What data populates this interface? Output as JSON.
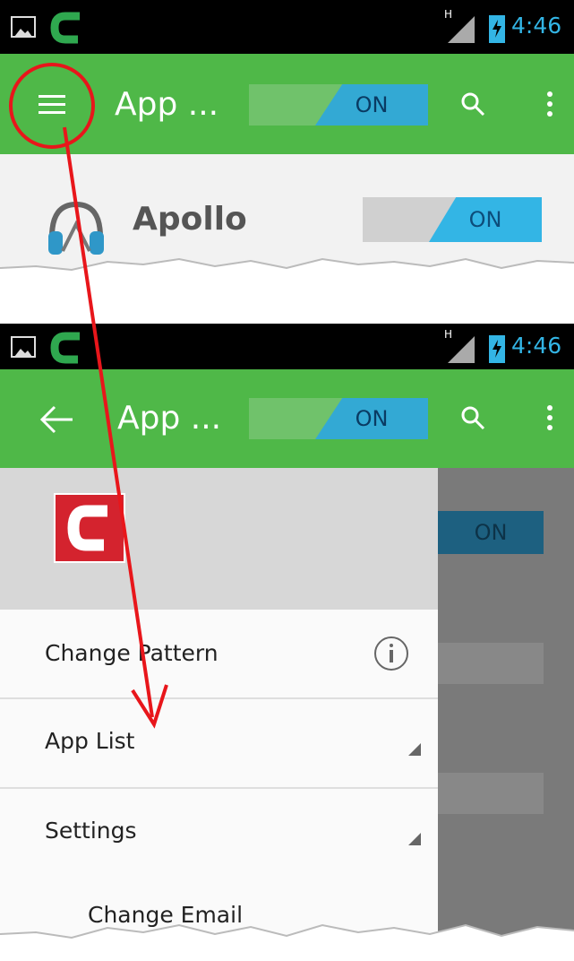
{
  "screen1": {
    "status_time": "4:46",
    "app_title": "App ...",
    "header_toggle": "ON",
    "app_row": {
      "name": "Apollo",
      "toggle": "ON"
    }
  },
  "screen2": {
    "status_time": "4:46",
    "app_title": "App ...",
    "header_toggle": "ON",
    "bg_toggle": "ON",
    "drawer": {
      "logo_letter": "C",
      "items": [
        {
          "label": "Change Pattern"
        },
        {
          "label": "App List"
        },
        {
          "label": "Settings"
        },
        {
          "label": "Change Email"
        }
      ]
    }
  },
  "colors": {
    "appbar": "#4fb848",
    "toggle_on": "#33a9d4",
    "annotation": "#e8161b",
    "logo": "#d4232e"
  },
  "icons": [
    "image-icon",
    "comodo-c-icon",
    "signal-icon",
    "battery-icon",
    "menu-icon",
    "search-icon",
    "overflow-icon",
    "back-arrow-icon",
    "headphones-icon",
    "info-icon"
  ]
}
